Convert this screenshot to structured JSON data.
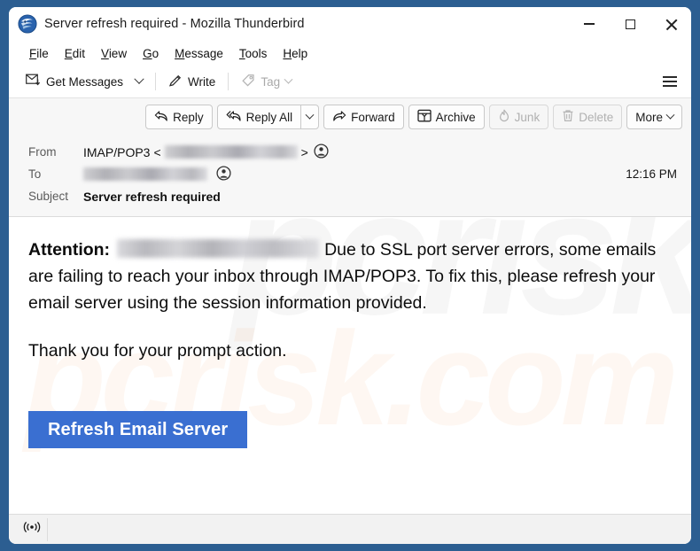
{
  "window": {
    "title": "Server refresh required - Mozilla Thunderbird",
    "app_icon": "thunderbird-icon",
    "controls": {
      "minimize": "minimize-icon",
      "maximize": "maximize-icon",
      "close": "close-icon"
    }
  },
  "menubar": {
    "items": [
      {
        "label": "File",
        "accesskey": "F",
        "rest": "ile"
      },
      {
        "label": "Edit",
        "accesskey": "E",
        "rest": "dit"
      },
      {
        "label": "View",
        "accesskey": "V",
        "rest": "iew"
      },
      {
        "label": "Go",
        "accesskey": "G",
        "rest": "o"
      },
      {
        "label": "Message",
        "accesskey": "M",
        "rest": "essage"
      },
      {
        "label": "Tools",
        "accesskey": "T",
        "rest": "ools"
      },
      {
        "label": "Help",
        "accesskey": "H",
        "rest": "elp"
      }
    ]
  },
  "toolbar": {
    "get_messages": "Get Messages",
    "write": "Write",
    "tag": "Tag",
    "tag_disabled": true,
    "app_menu": "hamburger-icon"
  },
  "message_actions": {
    "reply": "Reply",
    "reply_all": "Reply All",
    "forward": "Forward",
    "archive": "Archive",
    "junk": "Junk",
    "junk_disabled": true,
    "delete": "Delete",
    "delete_disabled": true,
    "more": "More"
  },
  "headers": {
    "from_label": "From",
    "from_display_name": "IMAP/POP3",
    "from_open_bracket": "<",
    "from_close_bracket": ">",
    "from_address_redacted": true,
    "to_label": "To",
    "to_address_redacted": true,
    "subject_label": "Subject",
    "subject_value": "Server refresh required",
    "time": "12:16 PM"
  },
  "body": {
    "attention_label": "Attention:",
    "recipient_redacted": true,
    "paragraph1": "Due to SSL port server errors, some emails are failing to reach your inbox through IMAP/POP3. To fix this, please refresh your email server using the session information provided.",
    "paragraph2": "Thank you for your prompt action.",
    "cta_label": "Refresh Email Server",
    "cta_color": "#3a6fd1",
    "watermark_grey": "pcrisk",
    "watermark_peach": "pcrisk.com"
  },
  "statusbar": {
    "indicator_icon": "broadcast-icon"
  },
  "colors": {
    "desktop_blue": "#2c5e91",
    "window_background": "#ffffff",
    "header_pane": "#f7f7f7",
    "cta_blue": "#3a6fd1",
    "status_bar": "#f2f2f2"
  }
}
